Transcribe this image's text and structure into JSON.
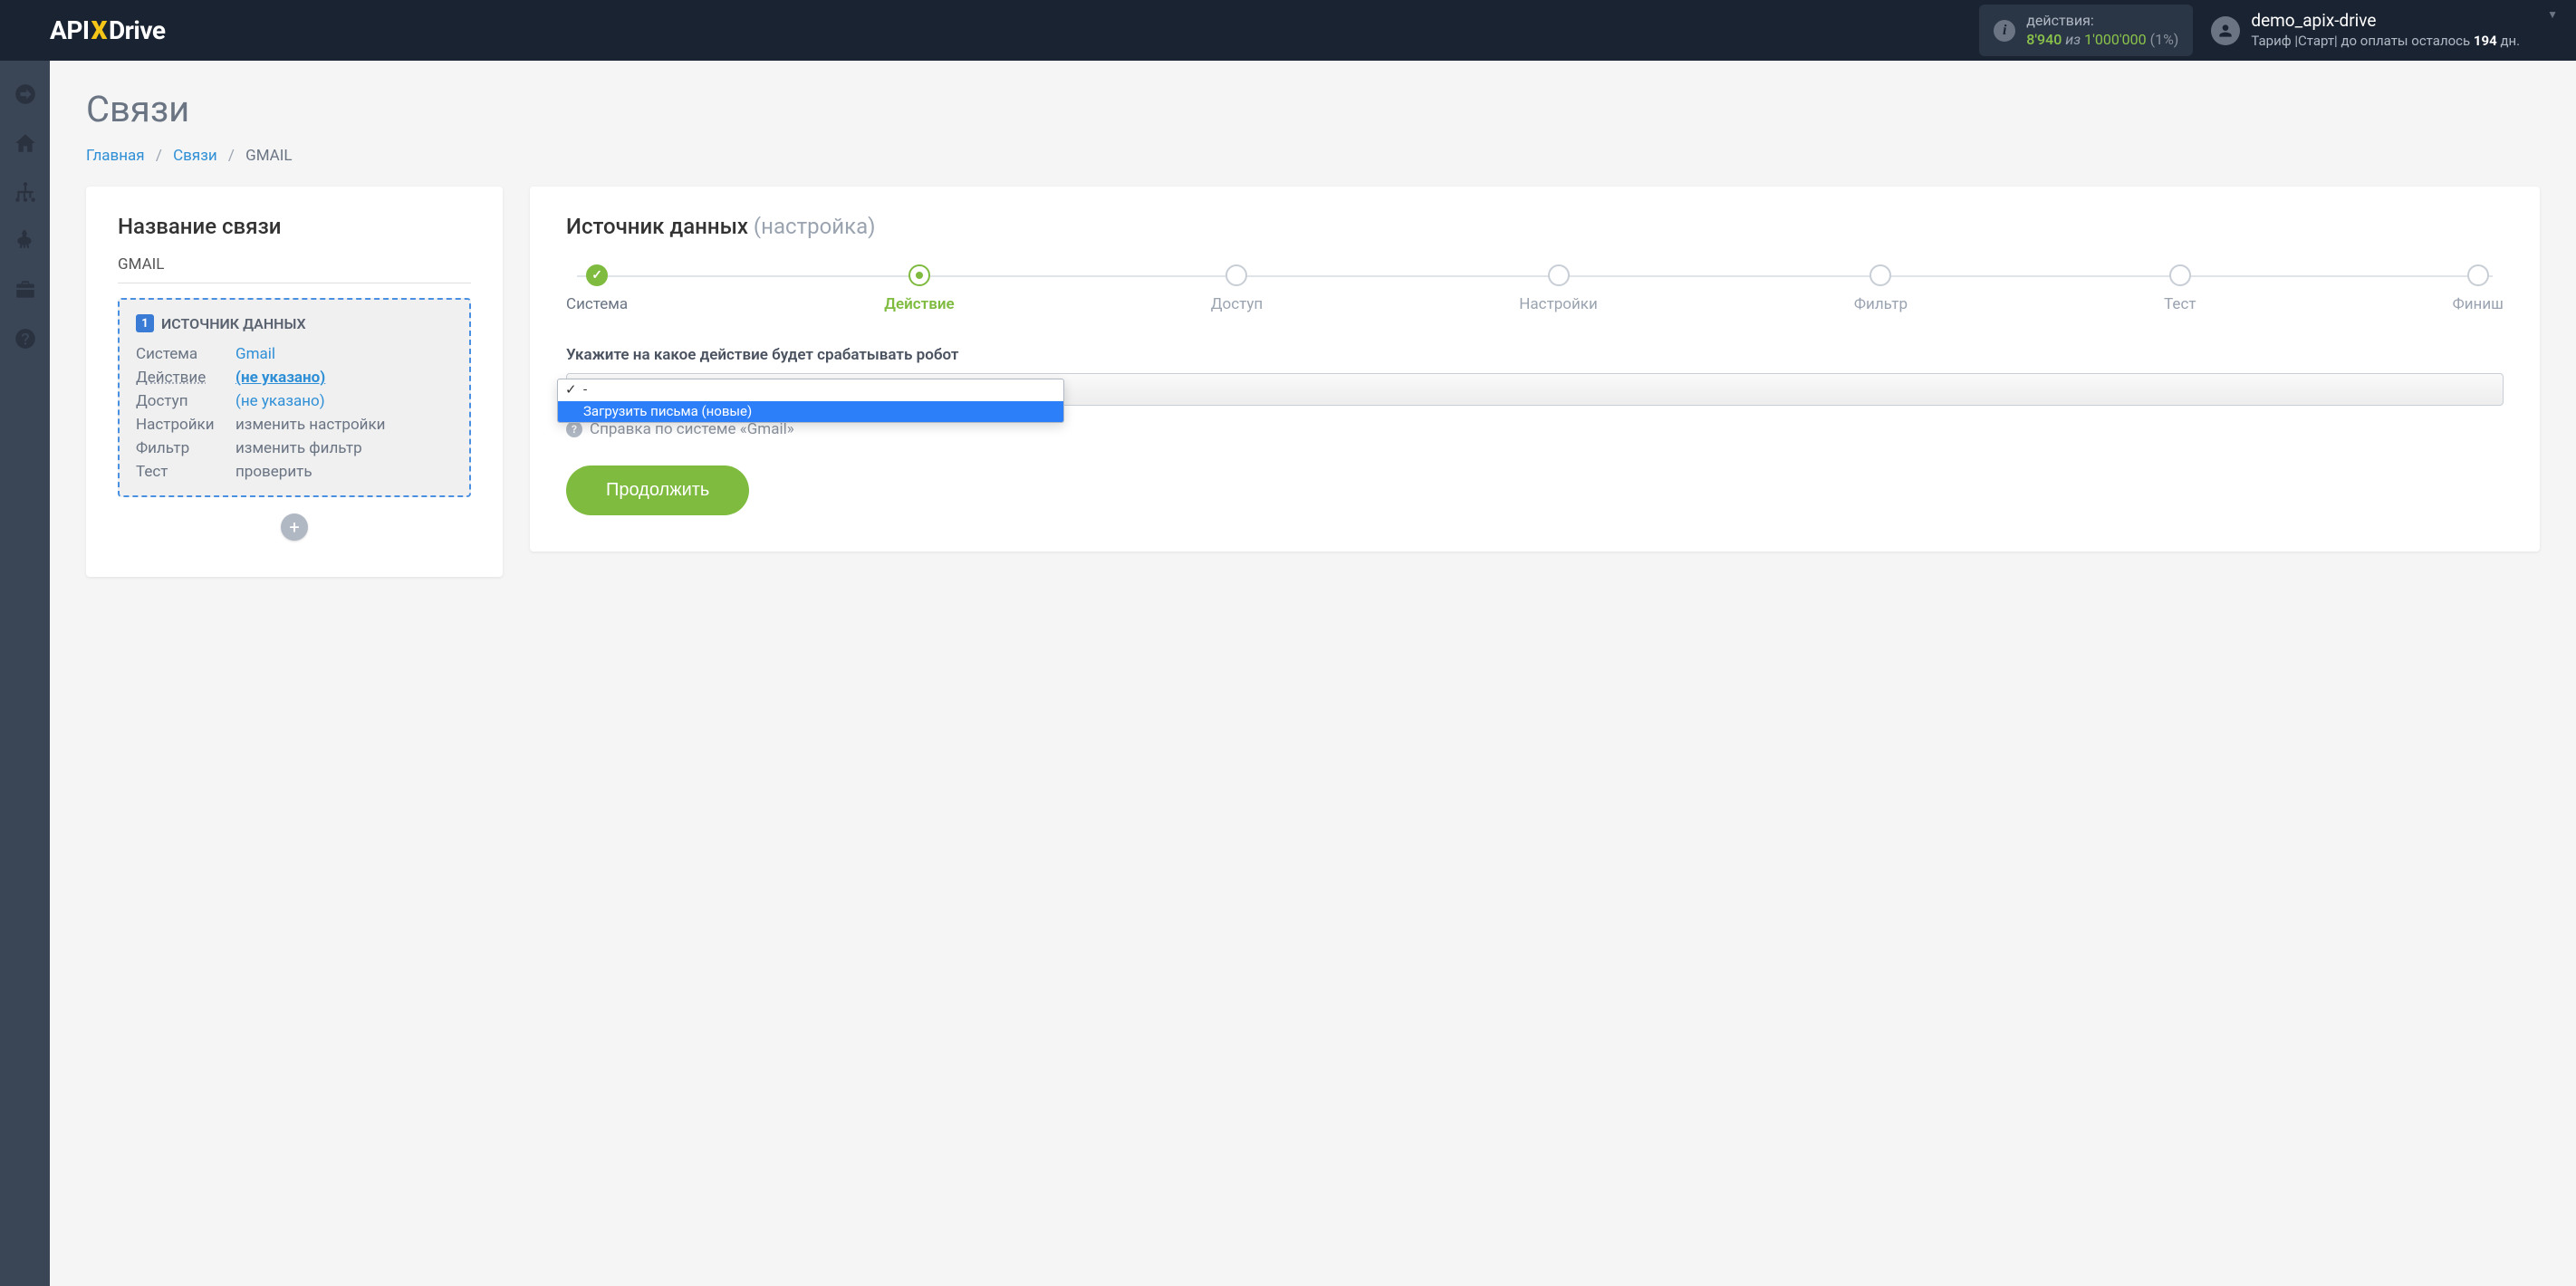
{
  "header": {
    "logo": {
      "api": "API",
      "x": "X",
      "drive": "Drive"
    },
    "actions": {
      "label": "действия:",
      "count": "8'940",
      "of": "из",
      "total": "1'000'000",
      "pct": "(1%)"
    },
    "user": {
      "name": "demo_apix-drive",
      "plan_prefix": "Тариф |Старт| до оплаты осталось ",
      "plan_days": "194",
      "plan_suffix": " дн."
    }
  },
  "page": {
    "title": "Связи",
    "breadcrumb": {
      "home": "Главная",
      "links": "Связи",
      "current": "GMAIL"
    }
  },
  "left_panel": {
    "title": "Название связи",
    "conn_name": "GMAIL",
    "source_box": {
      "badge": "1",
      "title": "ИСТОЧНИК ДАННЫХ",
      "rows": {
        "system": {
          "label": "Система",
          "value": "Gmail"
        },
        "action": {
          "label": "Действие",
          "value": "(не указано)"
        },
        "access": {
          "label": "Доступ",
          "value": "(не указано)"
        },
        "settings": {
          "label": "Настройки",
          "value": "изменить настройки"
        },
        "filter": {
          "label": "Фильтр",
          "value": "изменить фильтр"
        },
        "test": {
          "label": "Тест",
          "value": "проверить"
        }
      }
    }
  },
  "right_panel": {
    "title_main": "Источник данных ",
    "title_muted": "(настройка)",
    "steps": {
      "system": "Система",
      "action": "Действие",
      "access": "Доступ",
      "settings": "Настройки",
      "filter": "Фильтр",
      "test": "Тест",
      "finish": "Финиш"
    },
    "field_label": "Укажите на какое действие будет срабатывать робот",
    "dropdown": {
      "empty": "-",
      "option1": "Загрузить письма (новые)"
    },
    "help_text": "Справка по системе «Gmail»",
    "continue": "Продолжить"
  }
}
